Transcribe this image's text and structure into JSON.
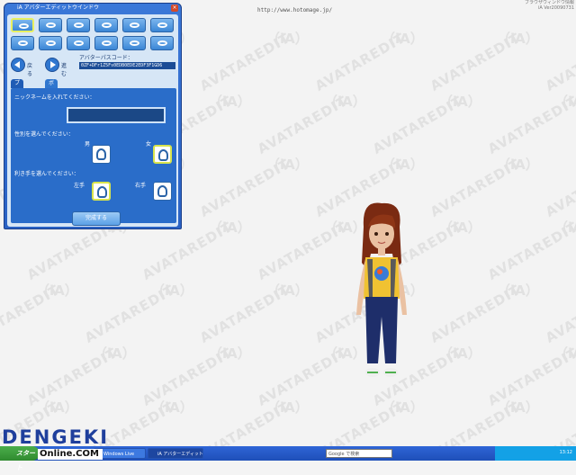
{
  "browser": {
    "url": "http://www.hotomage.jp/",
    "status_note": "ブラウザウィンドウ情報",
    "version_text": "iA Ver20090731"
  },
  "panel": {
    "title": "iA アバターエディットウインドウ",
    "close_label": "×",
    "prev_label": "戻る",
    "next_label": "進む",
    "passcode_label": "アバターパスコード：",
    "passcode_value": "0ZF+DFr1Z5Fs0EDB0EDE2EDF3F1GD6",
    "tabs": [
      "プロフィール",
      "ボイス"
    ],
    "nickname_prompt": "ニックネームを入れてください：",
    "nickname_value": "",
    "gender_prompt": "性別を選んでください：",
    "gender_male": "男",
    "gender_female": "女",
    "hand_prompt": "利き手を選んでください：",
    "hand_left": "左手",
    "hand_right": "右手",
    "submit_label": "完成する"
  },
  "watermark": {
    "text": "AVATAREDIT",
    "text2": "（iA）"
  },
  "taskbar": {
    "start_label": "スタート",
    "tasks": [
      "Windows Live",
      "iA アバターエディットウィ..."
    ],
    "search_placeholder": "Google で検索",
    "clock": "13:12"
  },
  "logo": {
    "brand": "DENGEKI",
    "sub": "Online.COM"
  },
  "colors": {
    "panel": "#2a62c4",
    "accent": "#d8e44c",
    "taskbar": "#2f65d7",
    "start": "#3a9a3a"
  }
}
